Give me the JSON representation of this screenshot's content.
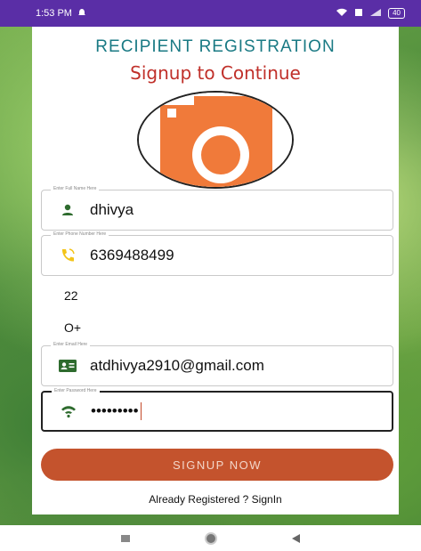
{
  "status_bar": {
    "time": "1:53 PM",
    "battery": "40"
  },
  "header": {
    "title": "RECIPIENT REGISTRATION",
    "subtitle": "Signup to Continue"
  },
  "form": {
    "name": {
      "label": "Enter Full Name Here",
      "value": "dhivya"
    },
    "phone": {
      "label": "Enter Phone Number Here",
      "value": "6369488499"
    },
    "age": {
      "value": "22"
    },
    "blood_group": {
      "value": "O+"
    },
    "email": {
      "label": "Enter Email Here",
      "value": "atdhivya2910@gmail.com"
    },
    "password": {
      "label": "Enter Password Here",
      "value": "•••••••••"
    }
  },
  "actions": {
    "signup_label": "SIGNUP NOW",
    "signin_label": "Already Registered ? SignIn"
  },
  "colors": {
    "accent": "#c4532d",
    "title": "#1a7a84",
    "subtitle": "#c0302a",
    "status_bar": "#5a2ea6",
    "camera": "#f07a3a"
  },
  "icons": [
    "person-icon",
    "phone-icon",
    "contact-card-icon",
    "key-icon",
    "camera-icon"
  ]
}
